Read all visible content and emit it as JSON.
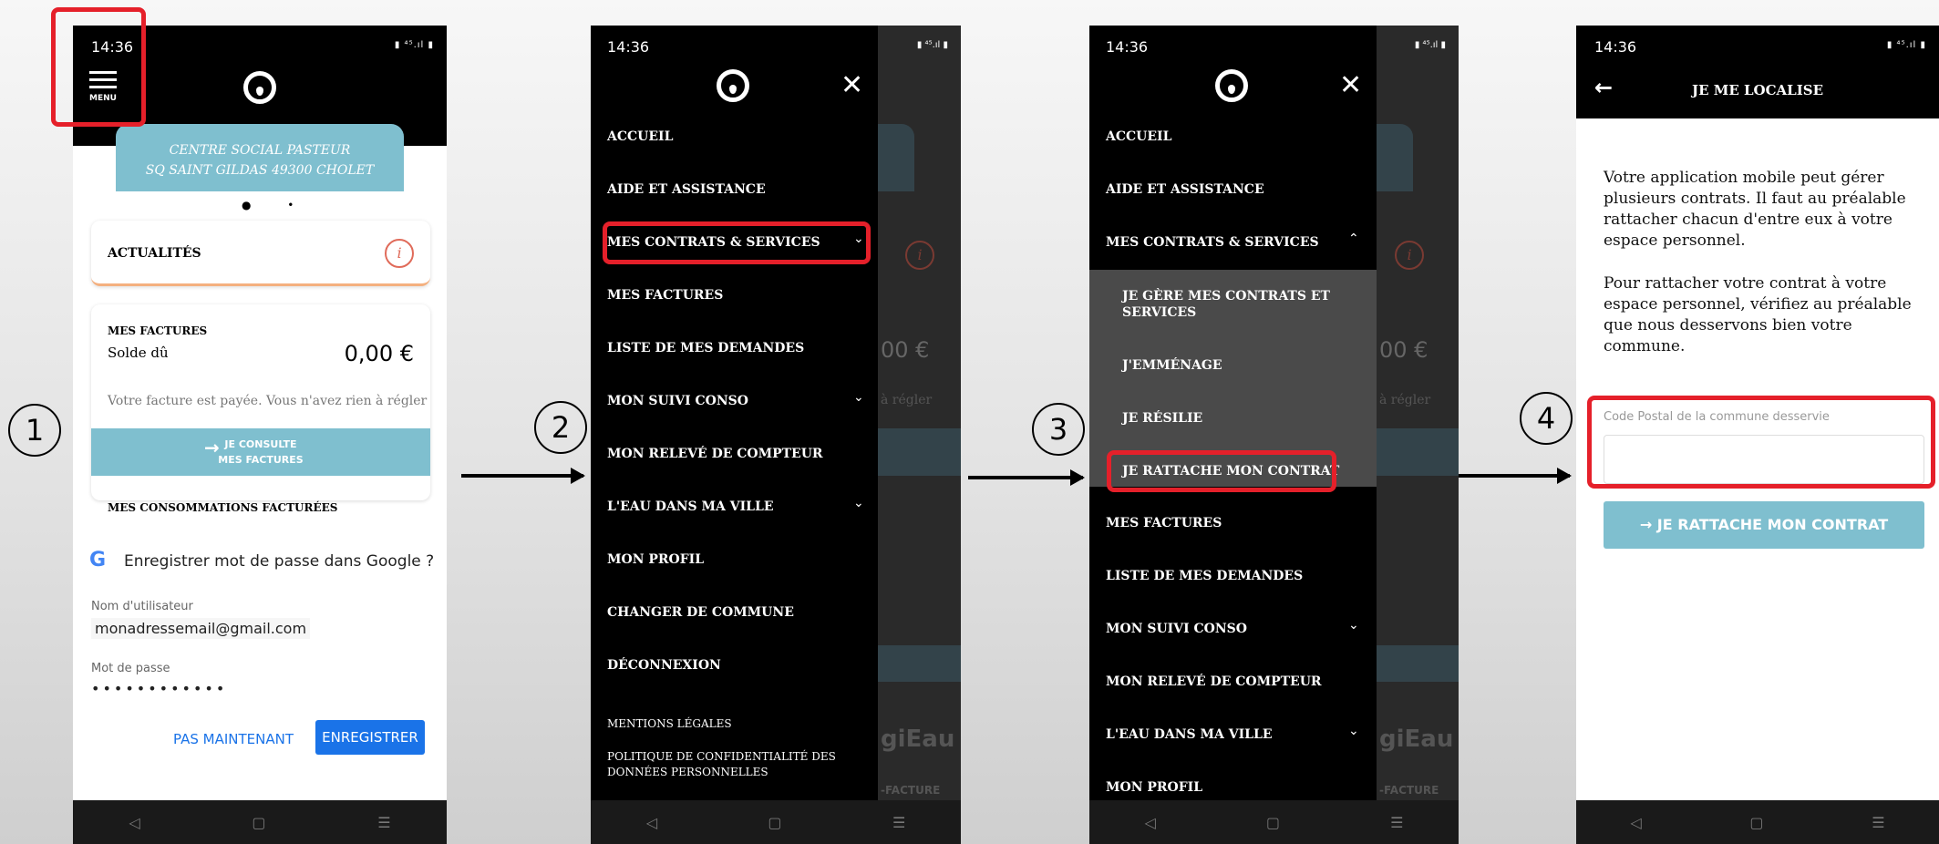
{
  "status": {
    "time": "14:36",
    "signal": "▮ ⁴⁵.ıl ▮"
  },
  "nav_buttons": [
    "◁",
    "▢",
    "☰"
  ],
  "steps": [
    "1",
    "2",
    "3",
    "4"
  ],
  "phone1": {
    "menu_label": "MENU",
    "address_line1": "CENTRE SOCIAL PASTEUR",
    "address_line2": "SQ SAINT GILDAS 49300 CHOLET",
    "pager_dots": "● •",
    "news_title": "ACTUALITÉS",
    "invoices_title": "MES FACTURES",
    "balance_label": "Solde dû",
    "balance_value": "0,00 €",
    "paid_message": "Votre facture est payée. Vous n'avez rien à régler",
    "consult_line1": "JE CONSULTE",
    "consult_line2": "MES FACTURES",
    "consumption_title": "MES CONSOMMATIONS FACTURÉES",
    "google_prompt": {
      "title": "Enregistrer mot de passe dans Google ?",
      "username_label": "Nom d'utilisateur",
      "username_value": "monadressemail@gmail.com",
      "password_label": "Mot de passe",
      "password_value": "••••••••••••",
      "later_button": "PAS MAINTENANT",
      "save_button": "ENREGISTRER"
    }
  },
  "phone2": {
    "menu_items": [
      "ACCUEIL",
      "AIDE ET ASSISTANCE",
      "MES CONTRATS & SERVICES",
      "MES FACTURES",
      "LISTE DE MES DEMANDES",
      "MON SUIVI CONSO",
      "MON RELEVÉ DE COMPTEUR",
      "L'EAU DANS MA VILLE",
      "MON PROFIL",
      "CHANGER DE COMMUNE",
      "DÉCONNEXION"
    ],
    "footer_items": [
      "MENTIONS LÉGALES",
      "POLITIQUE DE CONFIDENTIALITÉ DES DONNÉES PERSONNELLES"
    ]
  },
  "phone3": {
    "menu_items": [
      "ACCUEIL",
      "AIDE ET ASSISTANCE",
      "MES CONTRATS & SERVICES",
      "MES FACTURES",
      "LISTE DE MES DEMANDES",
      "MON SUIVI CONSO",
      "MON RELEVÉ DE COMPTEUR",
      "L'EAU DANS MA VILLE",
      "MON PROFIL"
    ],
    "sub_items": [
      "JE GÈRE MES CONTRATS ET SERVICES",
      "J'EMMÉNAGE",
      "JE RÉSILIE",
      "JE RATTACHE MON CONTRAT"
    ]
  },
  "background_fragments": {
    "amount": "00 €",
    "regler": "à régler",
    "brand": "giEau",
    "facture": "-FACTURE"
  },
  "phone4": {
    "title": "JE ME LOCALISE",
    "paragraph1": "Votre application mobile peut gérer plusieurs contrats. Il faut au préalable rattacher chacun d'entre eux à votre espace personnel.",
    "paragraph2": "Pour rattacher votre contrat à votre espace personnel, vérifiez au préalable que nous desservons bien votre commune.",
    "postal_label": "Code Postal de la commune desservie",
    "postal_value": "",
    "attach_button": "JE RATTACHE MON CONTRAT"
  },
  "colors": {
    "accent": "#7fbfcf",
    "highlight": "#e5202a",
    "google_blue": "#1a73e8",
    "info": "#e06b5a"
  }
}
